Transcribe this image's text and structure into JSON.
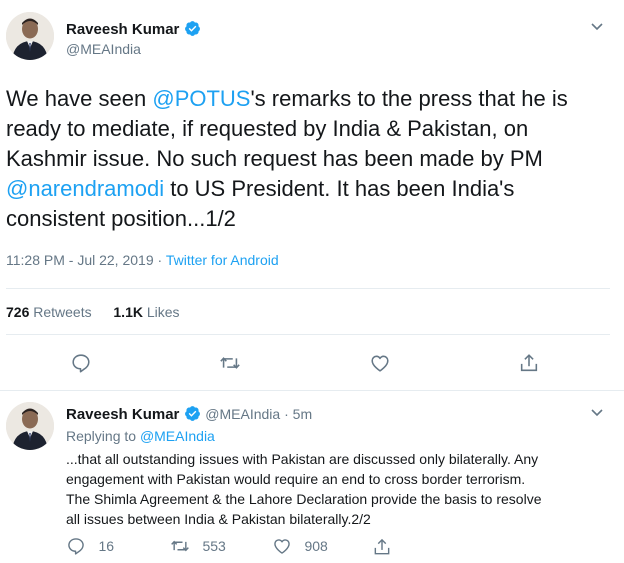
{
  "tweet": {
    "author_name": "Raveesh Kumar",
    "author_handle": "@MEAIndia",
    "text_lines": [
      [
        "We have seen ",
        "@POTUS",
        "'s remarks to the press that he is"
      ],
      [
        "ready to mediate, if requested by India & Pakistan, on"
      ],
      [
        "Kashmir issue. No such request has been made by PM"
      ],
      [
        "@narendramodi",
        " to US President. It has been India's"
      ],
      [
        "consistent position...1/2"
      ]
    ],
    "time": "11:28 PM - Jul 22, 2019",
    "meta_sep": " · ",
    "source": "Twitter for Android",
    "retweets_count": "726",
    "retweets_label": "Retweets",
    "likes_count": "1.1K",
    "likes_label": "Likes",
    "icons": {
      "verified": "verified-badge-icon",
      "menu": "chevron-down-icon",
      "reply": "reply-icon",
      "retweet": "retweet-icon",
      "like": "heart-icon",
      "share": "share-icon"
    }
  },
  "reply": {
    "author_name": "Raveesh Kumar",
    "author_handle": "@MEAIndia",
    "time_sep": " · ",
    "time_ago": "5m",
    "replying_label": "Replying to ",
    "replying_handle": "@MEAIndia",
    "text_lines": [
      "...that all outstanding issues with Pakistan are discussed only bilaterally. Any",
      "engagement with Pakistan would require an end to cross border terrorism.",
      "The Shimla Agreement & the Lahore Declaration provide the basis to resolve",
      "all issues between India & Pakistan bilaterally.2/2"
    ],
    "reply_count": "16",
    "retweet_count": "553",
    "like_count": "908"
  },
  "colors": {
    "link": "#1da1f2",
    "muted": "#657786",
    "text": "#14171a",
    "divider": "#e6ecf0"
  }
}
